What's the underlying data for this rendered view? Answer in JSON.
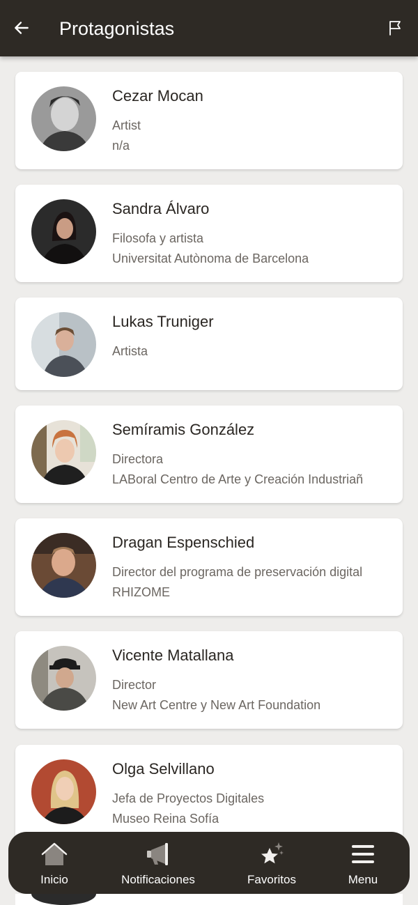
{
  "header": {
    "title": "Protagonistas",
    "back_icon": "arrow-left-icon",
    "flag_icon": "flag-icon"
  },
  "people": [
    {
      "name": "Cezar Mocan",
      "role": "Artist",
      "org": "n/a"
    },
    {
      "name": "Sandra Álvaro",
      "role": "Filosofa y artista",
      "org": "Universitat Autònoma de Barcelona"
    },
    {
      "name": "Lukas Truniger",
      "role": "Artista",
      "org": ""
    },
    {
      "name": "Semíramis González",
      "role": "Directora",
      "org": "LABoral Centro de Arte y Creación Industriañ"
    },
    {
      "name": "Dragan Espenschied",
      "role": "Director del programa de preservación digital",
      "org": "RHIZOME"
    },
    {
      "name": "Vicente Matallana",
      "role": "Director",
      "org": "New Art Centre y New Art Foundation"
    },
    {
      "name": "Olga Selvillano",
      "role": "Jefa de Proyectos Digitales",
      "org": "Museo Reina Sofía"
    }
  ],
  "nav": {
    "home": {
      "label": "Inicio",
      "icon": "home-icon"
    },
    "notifications": {
      "label": "Notificaciones",
      "icon": "megaphone-icon"
    },
    "favorites": {
      "label": "Favoritos",
      "icon": "star-sparkle-icon"
    },
    "menu": {
      "label": "Menu",
      "icon": "hamburger-menu-icon"
    }
  },
  "colors": {
    "header_bg": "#2e2a25",
    "nav_bg": "#2e2a25",
    "page_bg": "#eeedeb",
    "card_bg": "#ffffff"
  }
}
